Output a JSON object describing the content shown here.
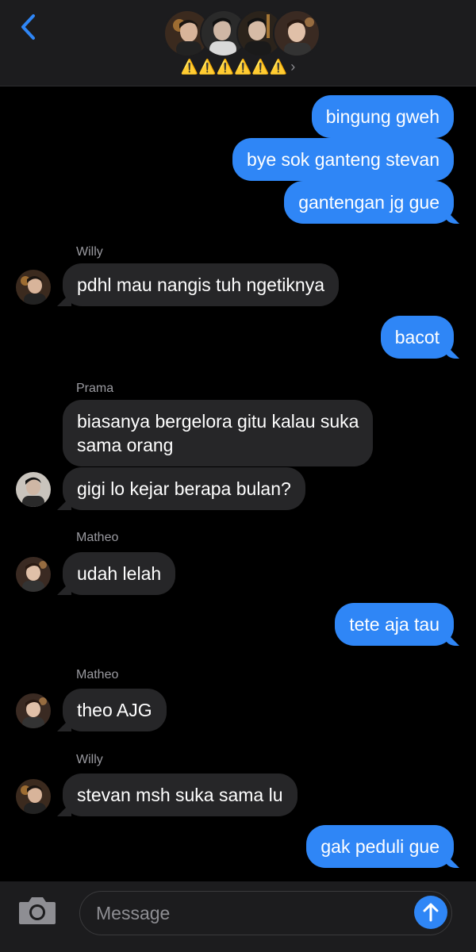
{
  "header": {
    "back_icon": "chevron-left-icon",
    "group_name": "⚠️⚠️⚠️⚠️⚠️⚠️",
    "chevron": "›",
    "avatar_count": 4
  },
  "colors": {
    "outgoing": "#2f86f6",
    "incoming": "#262628",
    "background": "#000000",
    "sender_label": "#9a9aa0"
  },
  "messages": [
    {
      "dir": "out",
      "text": "bingung gweh"
    },
    {
      "dir": "out",
      "text": "bye sok ganteng stevan"
    },
    {
      "dir": "out",
      "text": "gantengan jg gue"
    },
    {
      "dir": "in",
      "sender": "Willy",
      "text": "pdhl mau nangis tuh ngetiknya"
    },
    {
      "dir": "out",
      "text": "bacot"
    },
    {
      "dir": "in",
      "sender": "Prama",
      "text_lines": [
        "biasanya bergelora gitu kalau suka",
        "sama orang"
      ]
    },
    {
      "dir": "in",
      "text": "gigi lo kejar berapa bulan?"
    },
    {
      "dir": "in",
      "sender": "Matheo",
      "text": "udah lelah"
    },
    {
      "dir": "out",
      "text": "tete aja tau"
    },
    {
      "dir": "in",
      "sender": "Matheo",
      "text": "theo AJG"
    },
    {
      "dir": "in",
      "sender": "Willy",
      "text": "stevan msh suka sama lu"
    },
    {
      "dir": "out",
      "text": "gak peduli gue"
    }
  ],
  "composer": {
    "camera_icon": "camera-icon",
    "placeholder": "Message",
    "send_icon": "arrow-up-icon"
  }
}
